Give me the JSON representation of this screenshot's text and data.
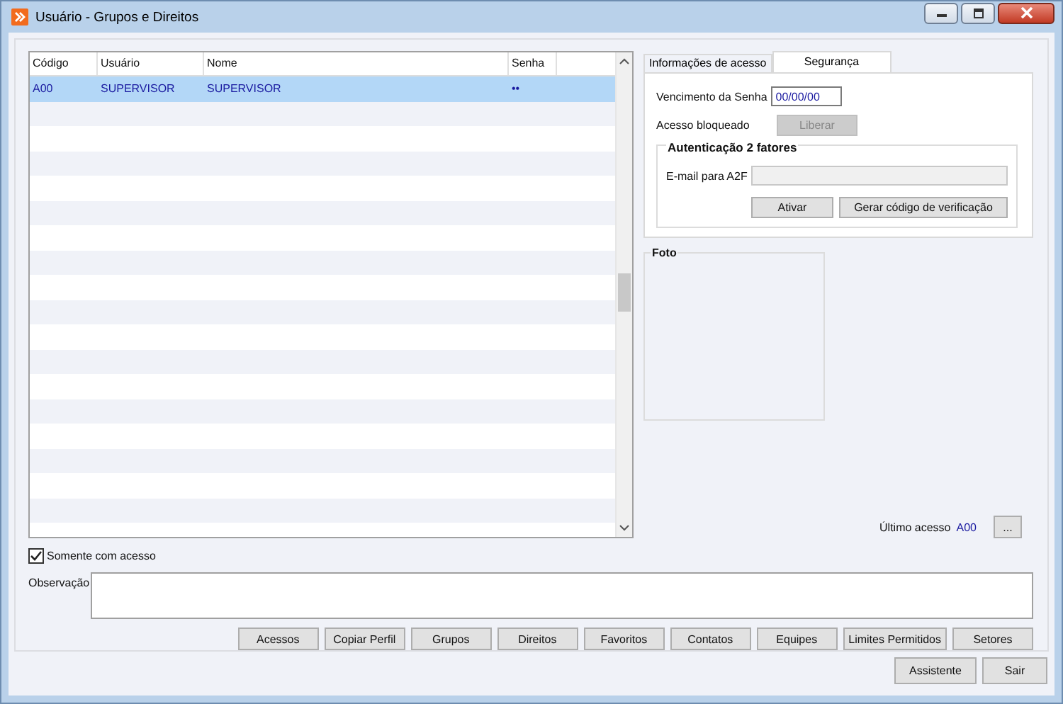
{
  "window": {
    "title": "Usuário - Grupos e Direitos"
  },
  "table": {
    "columns": [
      "Código",
      "Usuário",
      "Nome",
      "Senha"
    ],
    "rows": [
      {
        "cells": [
          "A00",
          "SUPERVISOR",
          "SUPERVISOR",
          "••"
        ],
        "selected": true
      }
    ]
  },
  "tabs": [
    {
      "label": "Informações de acesso",
      "selected": false
    },
    {
      "label": "Segurança",
      "selected": true
    }
  ],
  "security": {
    "expiry_label": "Vencimento da Senha",
    "expiry_value": "00/00/00",
    "blocked_label": "Acesso bloqueado",
    "unlock_button": {
      "label": "Liberar",
      "disabled": true
    },
    "two_factor": {
      "title": "Autenticação 2 fatores",
      "email_label": "E-mail para A2F",
      "buttons": [
        "Ativar",
        "Gerar código de verificação"
      ]
    }
  },
  "photo": {
    "title": "Foto"
  },
  "last_access": {
    "label": "Último acesso",
    "value": "A00",
    "button": "..."
  },
  "only_with_access": {
    "label": "Somente com acesso",
    "checked": true
  },
  "notes": {
    "label": "Observação"
  },
  "action_buttons": [
    "Acessos",
    "Copiar Perfil",
    "Grupos",
    "Direitos",
    "Favoritos",
    "Contatos",
    "Equipes",
    "Limites Permitidos",
    "Setores"
  ],
  "footer_buttons": [
    "Assistente",
    "Sair"
  ]
}
